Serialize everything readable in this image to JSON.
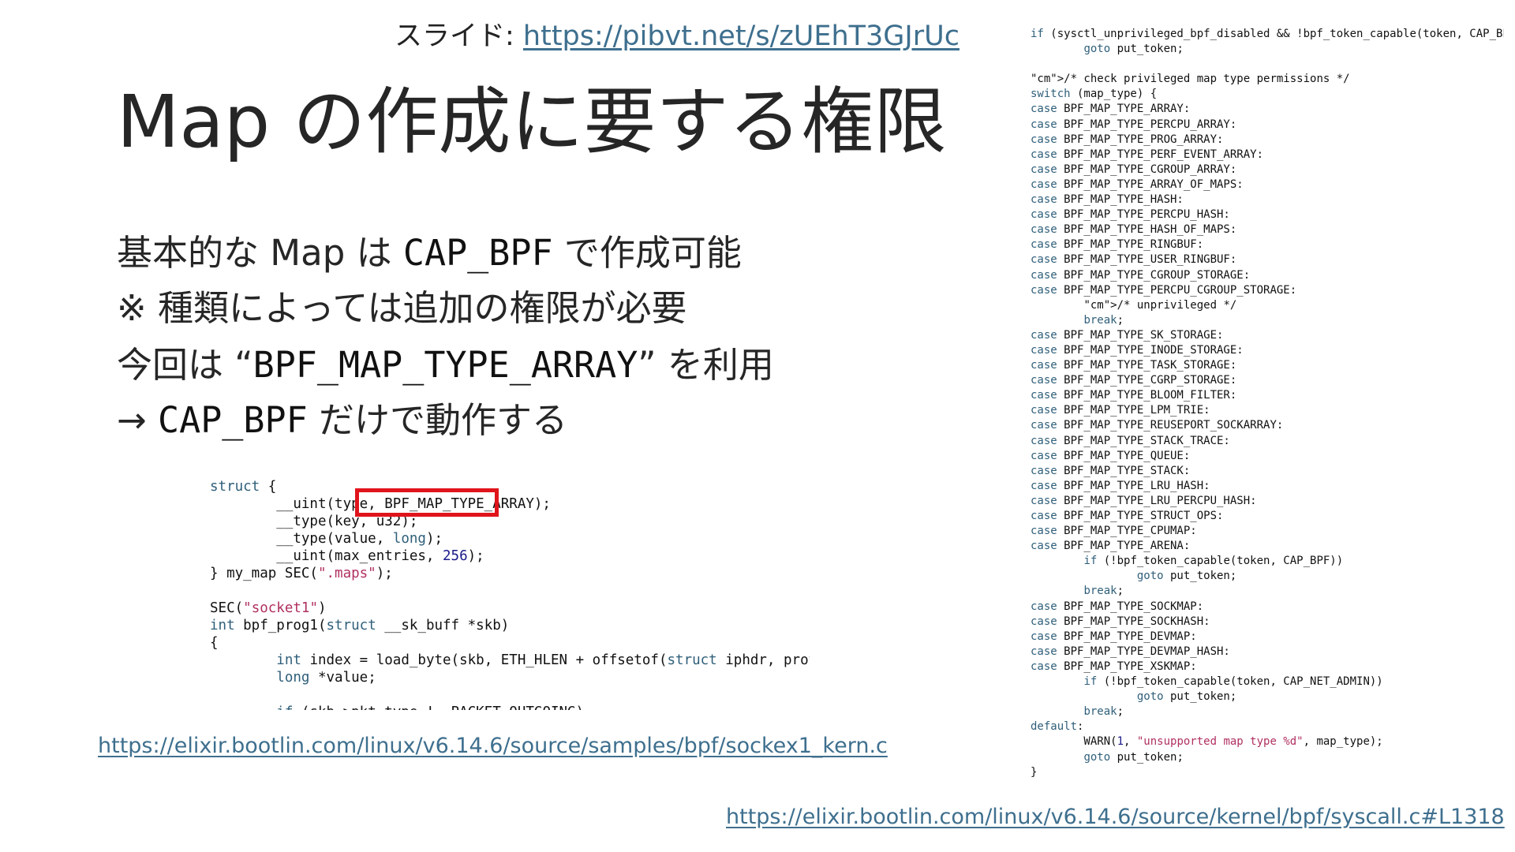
{
  "slide": {
    "link_prefix": "スライド: ",
    "link_url": "https://pibvt.net/s/zUEhT3GJrUc",
    "title": "Map の作成に要する権限",
    "lines": [
      {
        "a": "基本的な Map は ",
        "b": "CAP_BPF",
        "c": " で作成可能"
      },
      {
        "a": "※ 種類によっては追加の権限が必要"
      },
      {
        "a": "今回は “",
        "b": "BPF_MAP_TYPE_ARRAY",
        "c": "” を利用"
      },
      {
        "a": "→ ",
        "b": "CAP_BPF",
        "c": " だけで動作する"
      }
    ],
    "source_left": "https://elixir.bootlin.com/linux/v6.14.6/source/samples/bpf/sockex1_kern.c",
    "source_right": "https://elixir.bootlin.com/linux/v6.14.6/source/kernel/bpf/syscall.c#L1318"
  },
  "code_left": [
    "struct {",
    "        __uint(type, BPF_MAP_TYPE_ARRAY);",
    "        __type(key, u32);",
    "        __type(value, long);",
    "        __uint(max_entries, 256);",
    "} my_map SEC(\".maps\");",
    "",
    "SEC(\"socket1\")",
    "int bpf_prog1(struct __sk_buff *skb)",
    "{",
    "        int index = load_byte(skb, ETH_HLEN + offsetof(struct iphdr, protocol));",
    "        long *value;",
    "",
    "        if (skb->pkt_type != PACKET_OUTGOING)"
  ],
  "code_right": [
    "if (sysctl_unprivileged_bpf_disabled && !bpf_token_capable(token, CAP_BPF))",
    "        goto put_token;",
    "",
    "/* check privileged map type permissions */",
    "switch (map_type) {",
    "case BPF_MAP_TYPE_ARRAY:",
    "case BPF_MAP_TYPE_PERCPU_ARRAY:",
    "case BPF_MAP_TYPE_PROG_ARRAY:",
    "case BPF_MAP_TYPE_PERF_EVENT_ARRAY:",
    "case BPF_MAP_TYPE_CGROUP_ARRAY:",
    "case BPF_MAP_TYPE_ARRAY_OF_MAPS:",
    "case BPF_MAP_TYPE_HASH:",
    "case BPF_MAP_TYPE_PERCPU_HASH:",
    "case BPF_MAP_TYPE_HASH_OF_MAPS:",
    "case BPF_MAP_TYPE_RINGBUF:",
    "case BPF_MAP_TYPE_USER_RINGBUF:",
    "case BPF_MAP_TYPE_CGROUP_STORAGE:",
    "case BPF_MAP_TYPE_PERCPU_CGROUP_STORAGE:",
    "        /* unprivileged */",
    "        break;",
    "case BPF_MAP_TYPE_SK_STORAGE:",
    "case BPF_MAP_TYPE_INODE_STORAGE:",
    "case BPF_MAP_TYPE_TASK_STORAGE:",
    "case BPF_MAP_TYPE_CGRP_STORAGE:",
    "case BPF_MAP_TYPE_BLOOM_FILTER:",
    "case BPF_MAP_TYPE_LPM_TRIE:",
    "case BPF_MAP_TYPE_REUSEPORT_SOCKARRAY:",
    "case BPF_MAP_TYPE_STACK_TRACE:",
    "case BPF_MAP_TYPE_QUEUE:",
    "case BPF_MAP_TYPE_STACK:",
    "case BPF_MAP_TYPE_LRU_HASH:",
    "case BPF_MAP_TYPE_LRU_PERCPU_HASH:",
    "case BPF_MAP_TYPE_STRUCT_OPS:",
    "case BPF_MAP_TYPE_CPUMAP:",
    "case BPF_MAP_TYPE_ARENA:",
    "        if (!bpf_token_capable(token, CAP_BPF))",
    "                goto put_token;",
    "        break;",
    "case BPF_MAP_TYPE_SOCKMAP:",
    "case BPF_MAP_TYPE_SOCKHASH:",
    "case BPF_MAP_TYPE_DEVMAP:",
    "case BPF_MAP_TYPE_DEVMAP_HASH:",
    "case BPF_MAP_TYPE_XSKMAP:",
    "        if (!bpf_token_capable(token, CAP_NET_ADMIN))",
    "                goto put_token;",
    "        break;",
    "default:",
    "        WARN(1, \"unsupported map type %d\", map_type);",
    "        goto put_token;",
    "}"
  ]
}
